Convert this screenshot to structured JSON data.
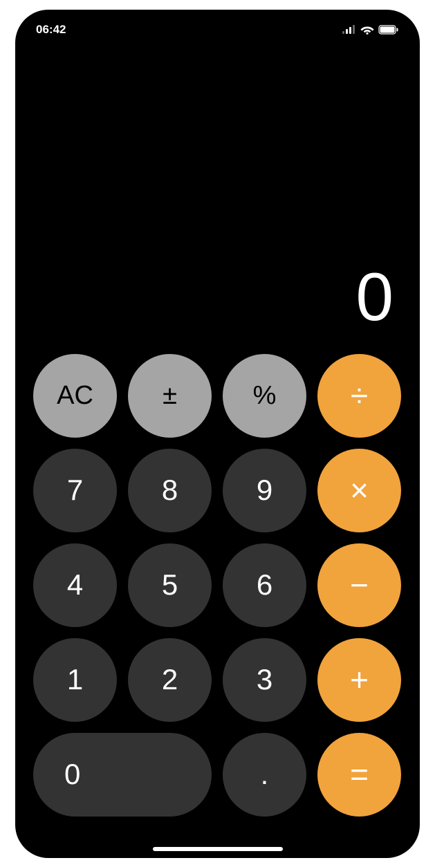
{
  "statusBar": {
    "time": "06:42"
  },
  "display": "0",
  "keys": {
    "clear": "AC",
    "sign": "±",
    "percent": "%",
    "divide": "÷",
    "seven": "7",
    "eight": "8",
    "nine": "9",
    "multiply": "×",
    "four": "4",
    "five": "5",
    "six": "6",
    "minus": "−",
    "one": "1",
    "two": "2",
    "three": "3",
    "plus": "+",
    "zero": "0",
    "decimal": ".",
    "equals": "="
  }
}
